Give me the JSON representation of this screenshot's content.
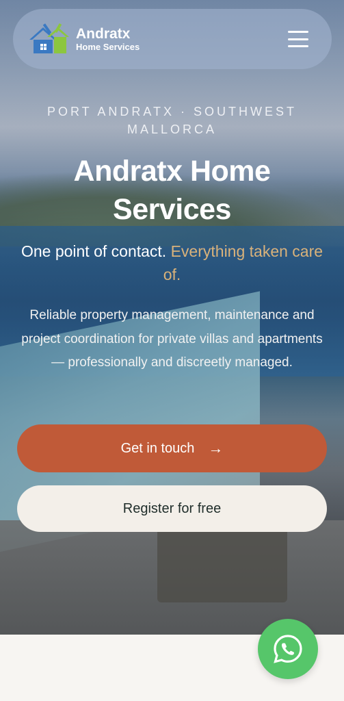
{
  "header": {
    "brand_name": "Andratx",
    "brand_sub": "Home Services",
    "logo_icon": "house-tools-logo",
    "menu_icon": "hamburger-menu-icon"
  },
  "hero": {
    "eyebrow": "PORT ANDRATX · SOUTHWEST MALLORCA",
    "title": "Andratx Home Services",
    "tagline_plain": "One point of contact. ",
    "tagline_accent": "Everything taken care of.",
    "description": "Reliable property management, maintenance and project coordination for private villas and apartments — professionally and discreetly managed.",
    "primary_button": "Get in touch",
    "primary_arrow": "→",
    "secondary_button": "Register for free"
  },
  "floating": {
    "whatsapp_icon": "whatsapp-icon"
  },
  "colors": {
    "accent": "#c05a38",
    "gold": "#d9b27a",
    "whatsapp": "#56c66a",
    "light_button": "#f3efe9",
    "logo_blue": "#3a79c2",
    "logo_green": "#8cc63f"
  }
}
